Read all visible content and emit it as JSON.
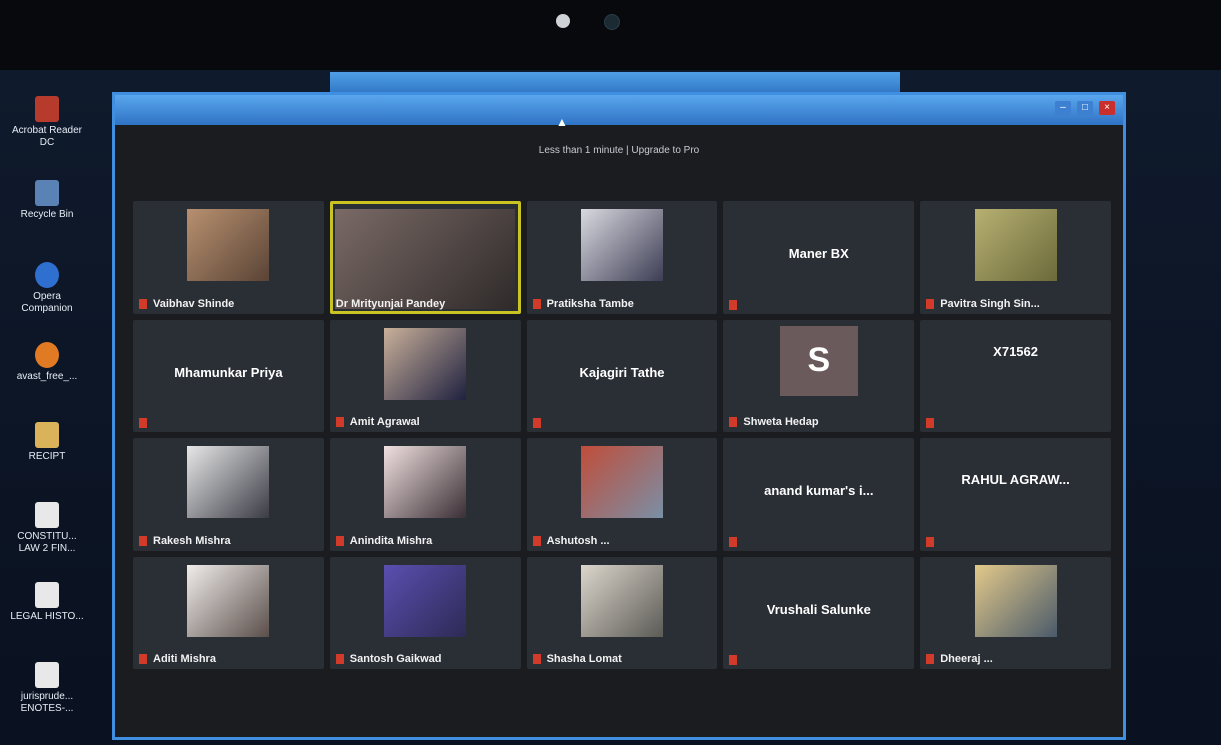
{
  "window": {
    "banner": "Less than 1 minute | Upgrade to Pro",
    "initial": "S"
  },
  "desktop_icons": [
    {
      "label": "Acrobat Reader DC",
      "color": "#b73b2c"
    },
    {
      "label": "Recycle Bin",
      "color": "#5b82b5"
    },
    {
      "label": "Opera Companion",
      "color": "#2f6fd0"
    },
    {
      "label": "avast_free_...",
      "color": "#e07a23"
    },
    {
      "label": "RECIPT",
      "color": "#d9b25a"
    },
    {
      "label": "CONSTITU... LAW 2 FIN...",
      "color": "#e8e8e8"
    },
    {
      "label": "LEGAL HISTO...",
      "color": "#e8e8e8"
    },
    {
      "label": "jurisprude... ENOTES-...",
      "color": "#e8e8e8"
    }
  ],
  "participants": [
    {
      "name": "Vaibhav Shinde",
      "video": true,
      "muted": true
    },
    {
      "name": "Dr Mrityunjai Pandey",
      "video": true,
      "muted": false,
      "active": true
    },
    {
      "name": "Pratiksha Tambe",
      "video": true,
      "muted": true
    },
    {
      "name": "Maner BX",
      "video": false,
      "muted": true
    },
    {
      "name": "Pavitra Singh Sin...",
      "video": true,
      "muted": true
    },
    {
      "name": "Mhamunkar Priya",
      "video": false,
      "muted": true
    },
    {
      "name": "Amit Agrawal",
      "video": true,
      "muted": true
    },
    {
      "name": "Kajagiri Tathe",
      "video": false,
      "muted": true
    },
    {
      "name": "Shweta Hedap",
      "video": false,
      "initial": true,
      "muted": true
    },
    {
      "name": "X71562",
      "video": false,
      "muted": true
    },
    {
      "name": "Rakesh Mishra",
      "video": true,
      "muted": true
    },
    {
      "name": "Anindita Mishra",
      "video": true,
      "muted": true
    },
    {
      "name": "Ashutosh ...",
      "video": true,
      "muted": true
    },
    {
      "name": "anand kumar's i...",
      "video": false,
      "muted": true
    },
    {
      "name": "RAHUL AGRAW...",
      "video": false,
      "muted": true
    },
    {
      "name": "Aditi Mishra",
      "video": true,
      "muted": true
    },
    {
      "name": "Santosh Gaikwad",
      "video": true,
      "muted": true
    },
    {
      "name": "Shasha Lomat",
      "video": true,
      "muted": true
    },
    {
      "name": "Vrushali Salunke",
      "video": false,
      "muted": true
    },
    {
      "name": "Dheeraj ...",
      "video": true,
      "muted": true
    }
  ]
}
